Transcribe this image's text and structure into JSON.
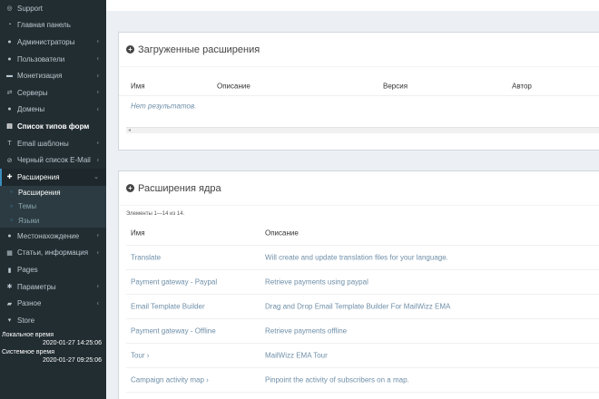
{
  "sidebar": {
    "items": [
      {
        "icon": "life-ring-icon",
        "label": "Support",
        "chevron": false
      },
      {
        "icon": "dashboard-icon",
        "label": "Главная панель",
        "chevron": false
      },
      {
        "icon": "user-icon",
        "label": "Администраторы",
        "chevron": true
      },
      {
        "icon": "users-icon",
        "label": "Пользователи",
        "chevron": true
      },
      {
        "icon": "money-icon",
        "label": "Монетизация",
        "chevron": true
      },
      {
        "icon": "exchange-icon",
        "label": "Серверы",
        "chevron": true
      },
      {
        "icon": "globe-icon",
        "label": "Домены",
        "chevron": true
      },
      {
        "icon": "list-icon",
        "label": "Список типов форм",
        "chevron": false,
        "bold": true
      },
      {
        "icon": "text-icon",
        "label": "Email шаблоны",
        "chevron": true
      },
      {
        "icon": "ban-icon",
        "label": "Черный список E-Mail",
        "chevron": true
      },
      {
        "icon": "puzzle-icon",
        "label": "Расширения",
        "chevron": true,
        "active": true
      }
    ],
    "subitems": [
      {
        "label": "Расширения",
        "current": true
      },
      {
        "label": "Темы",
        "current": false
      },
      {
        "label": "Языки",
        "current": false
      }
    ],
    "items_after": [
      {
        "icon": "map-marker-icon",
        "label": "Местонахождение",
        "chevron": true
      },
      {
        "icon": "book-icon",
        "label": "Статьи, информация",
        "chevron": true
      },
      {
        "icon": "file-icon",
        "label": "Pages",
        "chevron": false
      },
      {
        "icon": "cog-icon",
        "label": "Параметры",
        "chevron": true
      },
      {
        "icon": "folder-icon",
        "label": "Разное",
        "chevron": true
      },
      {
        "icon": "cart-icon",
        "label": "Store",
        "chevron": false
      }
    ],
    "local_time_label": "Локальное время",
    "local_time_value": "2020-01-27 14:25:06",
    "system_time_label": "Системное время",
    "system_time_value": "2020-01-27 09:25:06"
  },
  "panel_loaded": {
    "title": "Загруженные расширения",
    "columns": [
      "Имя",
      "Описание",
      "Версия",
      "Автор"
    ],
    "empty_text": "Нет результатов."
  },
  "panel_core": {
    "title": "Расширения ядра",
    "summary": "Элементы 1—14 из 14.",
    "columns": [
      "Имя",
      "Описание"
    ],
    "rows": [
      {
        "name": "Translate",
        "description": "Will create and update translation files for your language."
      },
      {
        "name": "Payment gateway - Paypal",
        "description": "Retrieve payments using paypal"
      },
      {
        "name": "Email Template Builder",
        "description": "Drag and Drop Email Template Builder For MailWizz EMA"
      },
      {
        "name": "Payment gateway - Offline",
        "description": "Retrieve payments offline"
      },
      {
        "name": "Tour ›",
        "description": "MailWizz EMA Tour"
      },
      {
        "name": "Campaign activity map ›",
        "description": "Pinpoint the activity of subscribers on a map."
      }
    ]
  }
}
